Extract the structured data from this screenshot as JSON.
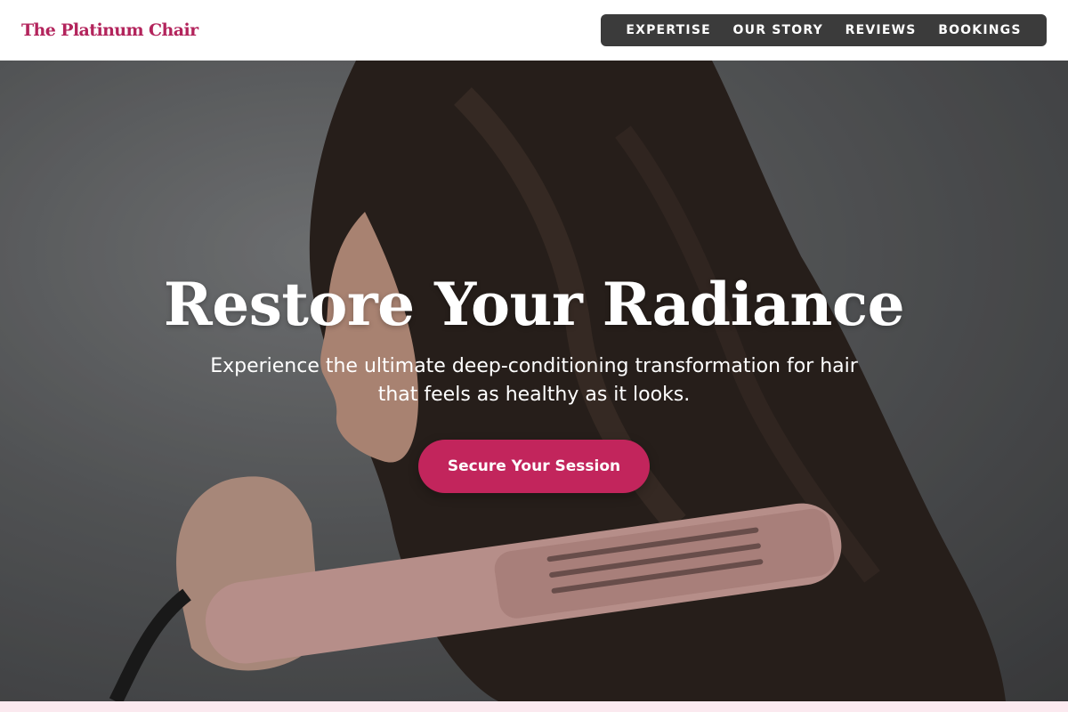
{
  "header": {
    "logo_text": "The Platinum Chair"
  },
  "nav": {
    "items": [
      {
        "label": "EXPERTISE"
      },
      {
        "label": "OUR STORY"
      },
      {
        "label": "REVIEWS"
      },
      {
        "label": "BOOKINGS"
      }
    ]
  },
  "hero": {
    "title": "Restore Your Radiance",
    "subtitle": "Experience the ultimate deep-conditioning transformation for hair that feels as healthy as it looks.",
    "cta_label": "Secure Your Session",
    "background_image": "woman-with-long-brown-wavy-hair-holding-pink-hair-straightener"
  },
  "colors": {
    "brand": "#b3245c",
    "cta": "#c2255c",
    "nav_bg": "#3b3b3b",
    "hero_bg": "#5d5f61",
    "bottom_strip": "#fbe9ef"
  }
}
